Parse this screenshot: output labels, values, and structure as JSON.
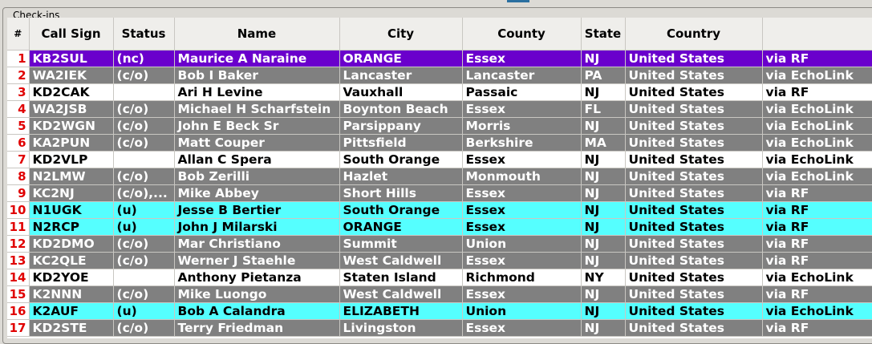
{
  "panel": {
    "title": "Check-ins"
  },
  "columns": [
    "#",
    "Call Sign",
    "Status",
    "Name",
    "City",
    "County",
    "State",
    "Country",
    ""
  ],
  "colors": {
    "purple": "#6a00cc",
    "gray": "#808080",
    "white": "#ffffff",
    "cyan": "#55ffff",
    "row_number": "#e00000"
  },
  "rows": [
    {
      "num": "1",
      "style": "purple",
      "callsign": "KB2SUL",
      "status": "(nc)",
      "name": "Maurice A Naraine",
      "city": "ORANGE",
      "county": "Essex",
      "state": "NJ",
      "country": "United States",
      "via": "via RF"
    },
    {
      "num": "2",
      "style": "gray",
      "callsign": "WA2IEK",
      "status": "(c/o)",
      "name": "Bob I Baker",
      "city": "Lancaster",
      "county": "Lancaster",
      "state": "PA",
      "country": "United States",
      "via": "via EchoLink"
    },
    {
      "num": "3",
      "style": "white",
      "callsign": "KD2CAK",
      "status": "",
      "name": "Ari H Levine",
      "city": "Vauxhall",
      "county": "Passaic",
      "state": "NJ",
      "country": "United States",
      "via": "via RF"
    },
    {
      "num": "4",
      "style": "gray",
      "callsign": "WA2JSB",
      "status": "(c/o)",
      "name": "Michael H Scharfstein",
      "city": "Boynton Beach",
      "county": "Essex",
      "state": "FL",
      "country": "United States",
      "via": "via EchoLink"
    },
    {
      "num": "5",
      "style": "gray",
      "callsign": "KD2WGN",
      "status": "(c/o)",
      "name": "John E Beck Sr",
      "city": "Parsippany",
      "county": "Morris",
      "state": "NJ",
      "country": "United States",
      "via": "via EchoLink"
    },
    {
      "num": "6",
      "style": "gray",
      "callsign": "KA2PUN",
      "status": "(c/o)",
      "name": "Matt Couper",
      "city": "Pittsfield",
      "county": "Berkshire",
      "state": "MA",
      "country": "United States",
      "via": "via EchoLink"
    },
    {
      "num": "7",
      "style": "white",
      "callsign": "KD2VLP",
      "status": "",
      "name": "Allan C Spera",
      "city": "South Orange",
      "county": "Essex",
      "state": "NJ",
      "country": "United States",
      "via": "via EchoLink"
    },
    {
      "num": "8",
      "style": "gray",
      "callsign": "N2LMW",
      "status": "(c/o)",
      "name": "Bob Zerilli",
      "city": "Hazlet",
      "county": "Monmouth",
      "state": "NJ",
      "country": "United States",
      "via": "via EchoLink"
    },
    {
      "num": "9",
      "style": "gray",
      "callsign": "KC2NJ",
      "status": "(c/o),...",
      "name": "Mike Abbey",
      "city": "Short Hills",
      "county": "Essex",
      "state": "NJ",
      "country": "United States",
      "via": "via RF"
    },
    {
      "num": "10",
      "style": "cyan",
      "callsign": "N1UGK",
      "status": "(u)",
      "name": "Jesse B Bertier",
      "city": "South Orange",
      "county": "Essex",
      "state": "NJ",
      "country": "United States",
      "via": "via RF"
    },
    {
      "num": "11",
      "style": "cyan",
      "callsign": "N2RCP",
      "status": "(u)",
      "name": "John J Milarski",
      "city": "ORANGE",
      "county": "Essex",
      "state": "NJ",
      "country": "United States",
      "via": "via RF"
    },
    {
      "num": "12",
      "style": "gray",
      "callsign": "KD2DMO",
      "status": "(c/o)",
      "name": "Mar Christiano",
      "city": "Summit",
      "county": "Union",
      "state": "NJ",
      "country": "United States",
      "via": "via RF"
    },
    {
      "num": "13",
      "style": "gray",
      "callsign": "KC2QLE",
      "status": "(c/o)",
      "name": "Werner J Staehle",
      "city": "West Caldwell",
      "county": "Essex",
      "state": "NJ",
      "country": "United States",
      "via": "via RF"
    },
    {
      "num": "14",
      "style": "white",
      "callsign": "KD2YOE",
      "status": "",
      "name": "Anthony Pietanza",
      "city": "Staten Island",
      "county": "Richmond",
      "state": "NY",
      "country": "United States",
      "via": "via EchoLink"
    },
    {
      "num": "15",
      "style": "gray",
      "callsign": "K2NNN",
      "status": "(c/o)",
      "name": "Mike Luongo",
      "city": "West Caldwell",
      "county": "Essex",
      "state": "NJ",
      "country": "United States",
      "via": "via RF"
    },
    {
      "num": "16",
      "style": "cyan",
      "callsign": "K2AUF",
      "status": "(u)",
      "name": "Bob A Calandra",
      "city": "ELIZABETH",
      "county": "Union",
      "state": "NJ",
      "country": "United States",
      "via": "via EchoLink"
    },
    {
      "num": "17",
      "style": "gray",
      "callsign": "KD2STE",
      "status": "(c/o)",
      "name": "Terry Friedman",
      "city": "Livingston",
      "county": "Essex",
      "state": "NJ",
      "country": "United States",
      "via": "via RF"
    }
  ]
}
